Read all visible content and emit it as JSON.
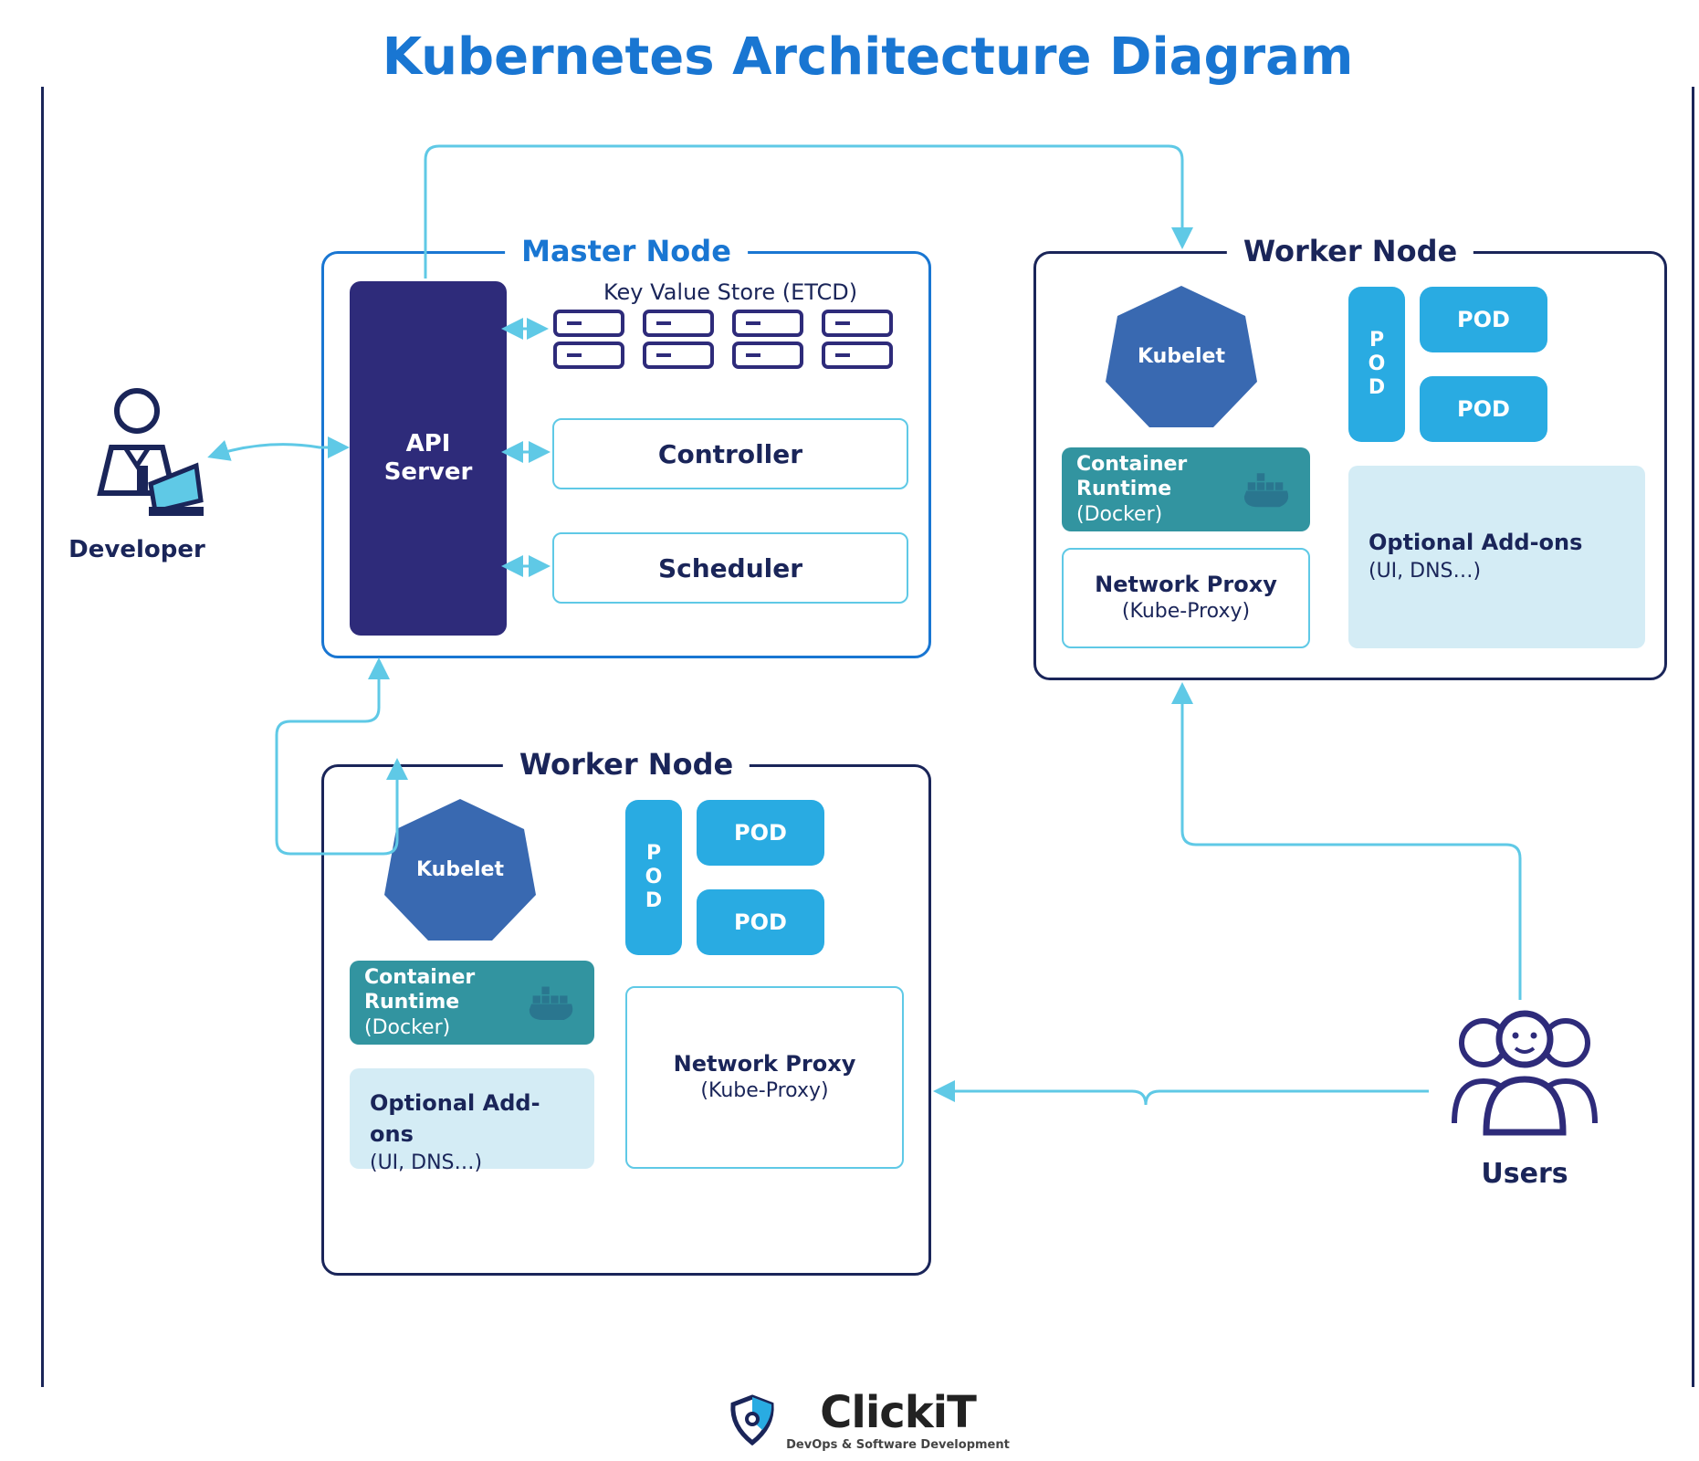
{
  "title": "Kubernetes Architecture Diagram",
  "developer_label": "Developer",
  "users_label": "Users",
  "master": {
    "label": "Master Node",
    "api_server": "API\nServer",
    "etcd_label": "Key Value Store (ETCD)",
    "controller": "Controller",
    "scheduler": "Scheduler"
  },
  "worker": {
    "label": "Worker Node",
    "kubelet": "Kubelet",
    "runtime_title": "Container Runtime",
    "runtime_sub": "(Docker)",
    "netproxy_title": "Network Proxy",
    "netproxy_sub": "(Kube-Proxy)",
    "addons_title": "Optional Add-ons",
    "addons_sub": "(UI, DNS…)",
    "pod_v": "POD",
    "pod_h1": "POD",
    "pod_h2": "POD"
  },
  "logo": {
    "name": "ClickiT",
    "tagline": "DevOps & Software Development"
  },
  "colors": {
    "navy": "#1a2559",
    "blue": "#1976d2",
    "light_blue": "#5fc9e6",
    "cyan": "#29abe2",
    "teal": "#3294a0",
    "pale_blue": "#d4ecf5",
    "dark_indigo": "#2e2b7a",
    "mid_blue": "#3969b1"
  },
  "structure": {
    "actors": [
      "Developer",
      "Users"
    ],
    "master_components": [
      "API Server",
      "Key Value Store (ETCD)",
      "Controller",
      "Scheduler"
    ],
    "worker_components": [
      "Kubelet",
      "Container Runtime (Docker)",
      "Network Proxy (Kube-Proxy)",
      "POD",
      "Optional Add-ons (UI, DNS…)"
    ],
    "connections": [
      {
        "from": "Developer",
        "to": "API Server",
        "kind": "bidirectional"
      },
      {
        "from": "API Server",
        "to": "ETCD",
        "kind": "bidirectional"
      },
      {
        "from": "API Server",
        "to": "Controller",
        "kind": "bidirectional"
      },
      {
        "from": "API Server",
        "to": "Scheduler",
        "kind": "bidirectional"
      },
      {
        "from": "API Server",
        "to": "Worker Node (right)",
        "kind": "directed"
      },
      {
        "from": "API Server",
        "to": "Worker Node (bottom)",
        "kind": "bidirectional"
      },
      {
        "from": "Users",
        "to": "Worker Node (bottom) Network Proxy",
        "kind": "directed"
      },
      {
        "from": "Users",
        "to": "Worker Node (right) Network Proxy",
        "kind": "directed"
      }
    ]
  }
}
